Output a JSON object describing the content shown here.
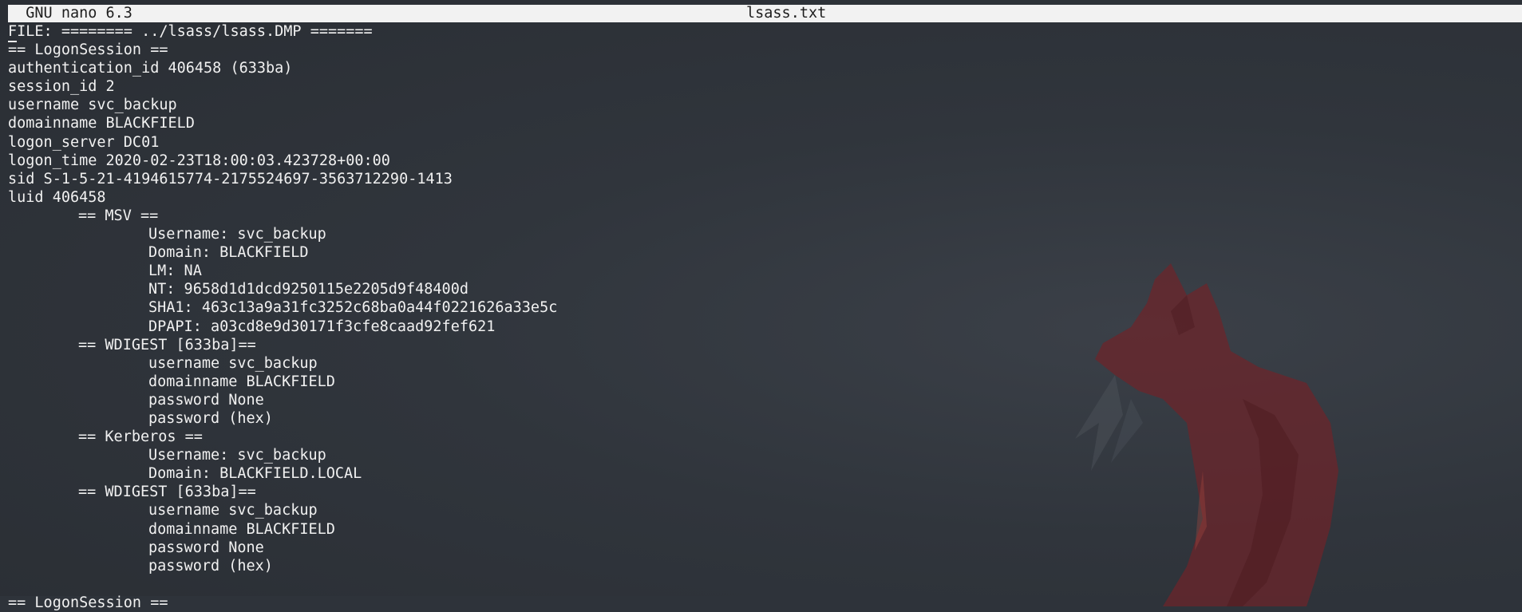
{
  "titlebar": {
    "app": "  GNU nano 6.3",
    "filename": "lsass.txt"
  },
  "editor": {
    "cursor_char": "F",
    "lines": [
      {
        "indent": 0,
        "text": "ILE: ======== ../lsass/lsass.DMP ======="
      },
      {
        "indent": 0,
        "text": "== LogonSession =="
      },
      {
        "indent": 0,
        "text": "authentication_id 406458 (633ba)"
      },
      {
        "indent": 0,
        "text": "session_id 2"
      },
      {
        "indent": 0,
        "text": "username svc_backup"
      },
      {
        "indent": 0,
        "text": "domainname BLACKFIELD"
      },
      {
        "indent": 0,
        "text": "logon_server DC01"
      },
      {
        "indent": 0,
        "text": "logon_time 2020-02-23T18:00:03.423728+00:00"
      },
      {
        "indent": 0,
        "text": "sid S-1-5-21-4194615774-2175524697-3563712290-1413"
      },
      {
        "indent": 0,
        "text": "luid 406458"
      },
      {
        "indent": 1,
        "text": "== MSV =="
      },
      {
        "indent": 2,
        "text": "Username: svc_backup"
      },
      {
        "indent": 2,
        "text": "Domain: BLACKFIELD"
      },
      {
        "indent": 2,
        "text": "LM: NA"
      },
      {
        "indent": 2,
        "text": "NT: 9658d1d1dcd9250115e2205d9f48400d"
      },
      {
        "indent": 2,
        "text": "SHA1: 463c13a9a31fc3252c68ba0a44f0221626a33e5c"
      },
      {
        "indent": 2,
        "text": "DPAPI: a03cd8e9d30171f3cfe8caad92fef621"
      },
      {
        "indent": 1,
        "text": "== WDIGEST [633ba]=="
      },
      {
        "indent": 2,
        "text": "username svc_backup"
      },
      {
        "indent": 2,
        "text": "domainname BLACKFIELD"
      },
      {
        "indent": 2,
        "text": "password None"
      },
      {
        "indent": 2,
        "text": "password (hex)"
      },
      {
        "indent": 1,
        "text": "== Kerberos =="
      },
      {
        "indent": 2,
        "text": "Username: svc_backup"
      },
      {
        "indent": 2,
        "text": "Domain: BLACKFIELD.LOCAL"
      },
      {
        "indent": 1,
        "text": "== WDIGEST [633ba]=="
      },
      {
        "indent": 2,
        "text": "username svc_backup"
      },
      {
        "indent": 2,
        "text": "domainname BLACKFIELD"
      },
      {
        "indent": 2,
        "text": "password None"
      },
      {
        "indent": 2,
        "text": "password (hex)"
      },
      {
        "indent": 0,
        "text": ""
      },
      {
        "indent": 0,
        "text": "== LogonSession =="
      }
    ]
  },
  "colors": {
    "background": "#2e333a",
    "text": "#f1f1f1",
    "titlebar_bg": "#f2f2f2",
    "titlebar_fg": "#1e1e1e",
    "fox": "#6e2429"
  },
  "wallpaper_icon": "fox-silhouette-icon"
}
